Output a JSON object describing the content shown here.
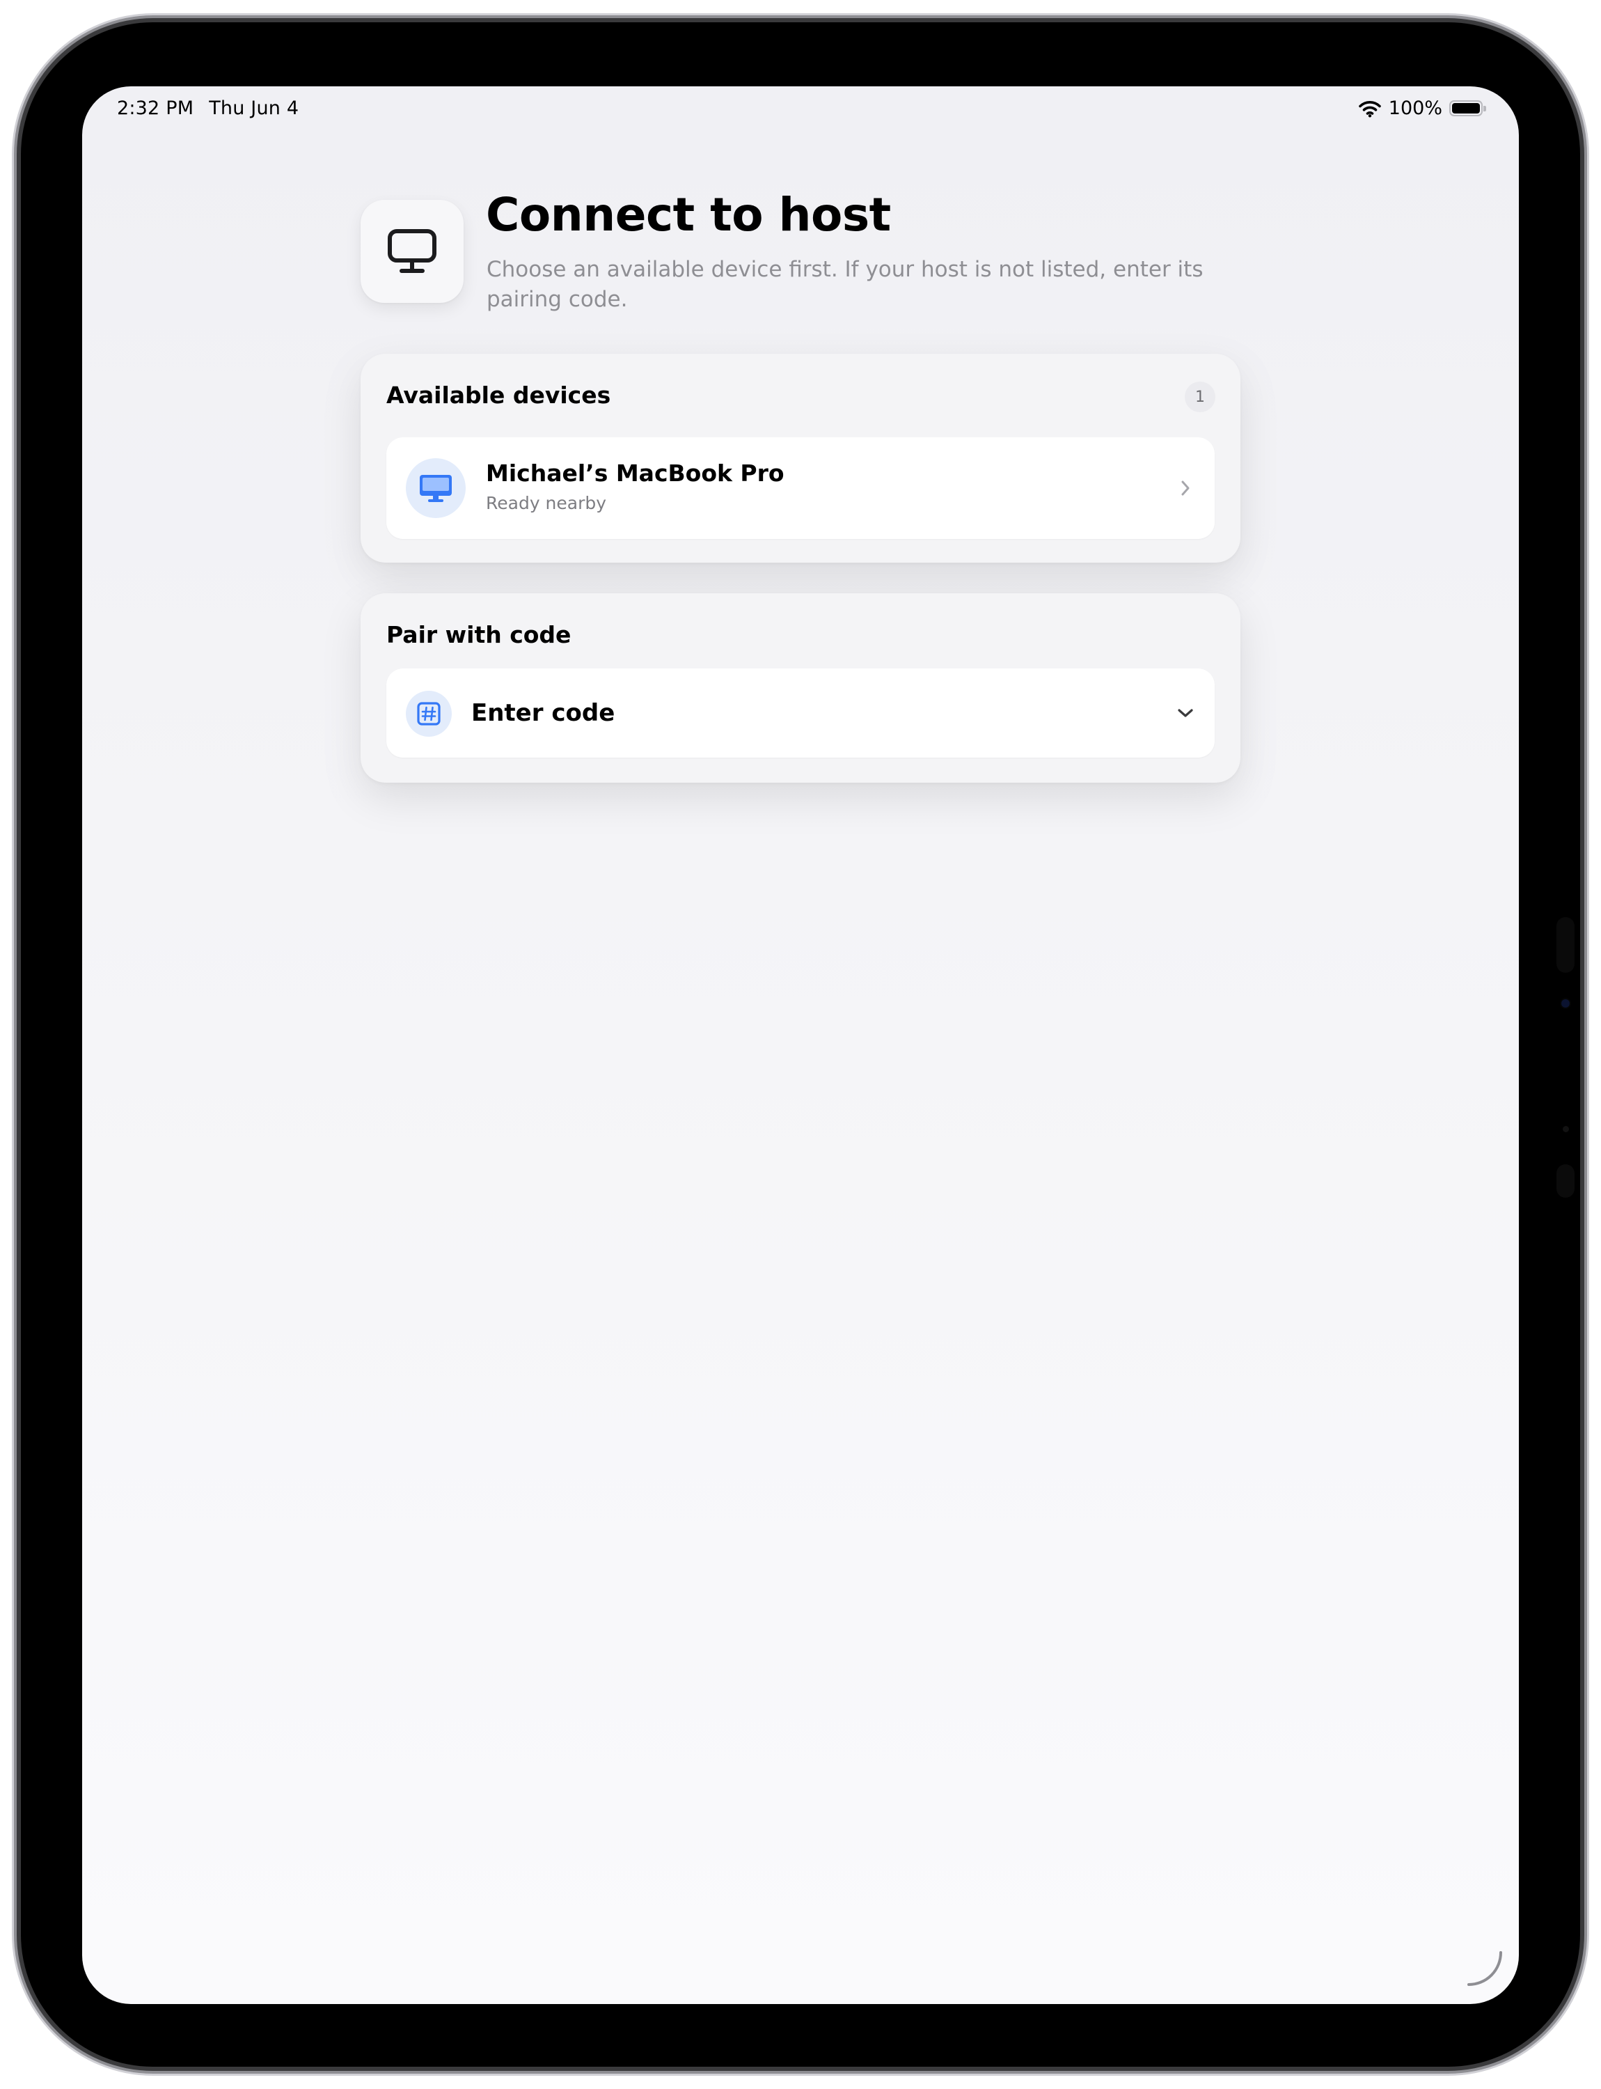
{
  "status_bar": {
    "time": "2:32 PM",
    "date": "Thu Jun 4",
    "battery_percent": "100%",
    "battery_level": 1.0,
    "icons": [
      "wifi-icon",
      "battery-icon"
    ]
  },
  "header": {
    "icon": "monitor-icon",
    "title": "Connect to host",
    "subtitle": "Choose an available device first. If your host is not listed, enter its pairing code."
  },
  "available_devices": {
    "title": "Available devices",
    "count": "1",
    "items": [
      {
        "name": "Michael’s MacBook Pro",
        "status": "Ready nearby",
        "icon": "desktop-computer-icon"
      }
    ]
  },
  "pair_with_code": {
    "title": "Pair with code",
    "field_label": "Enter code",
    "icon": "hashtag-icon",
    "expanded": false
  },
  "colors": {
    "accent": "#3478f6",
    "icon_circle_bg": "#e3ecfb",
    "secondary_text": "#8e8e93",
    "card_bg": "#f4f4f6"
  }
}
